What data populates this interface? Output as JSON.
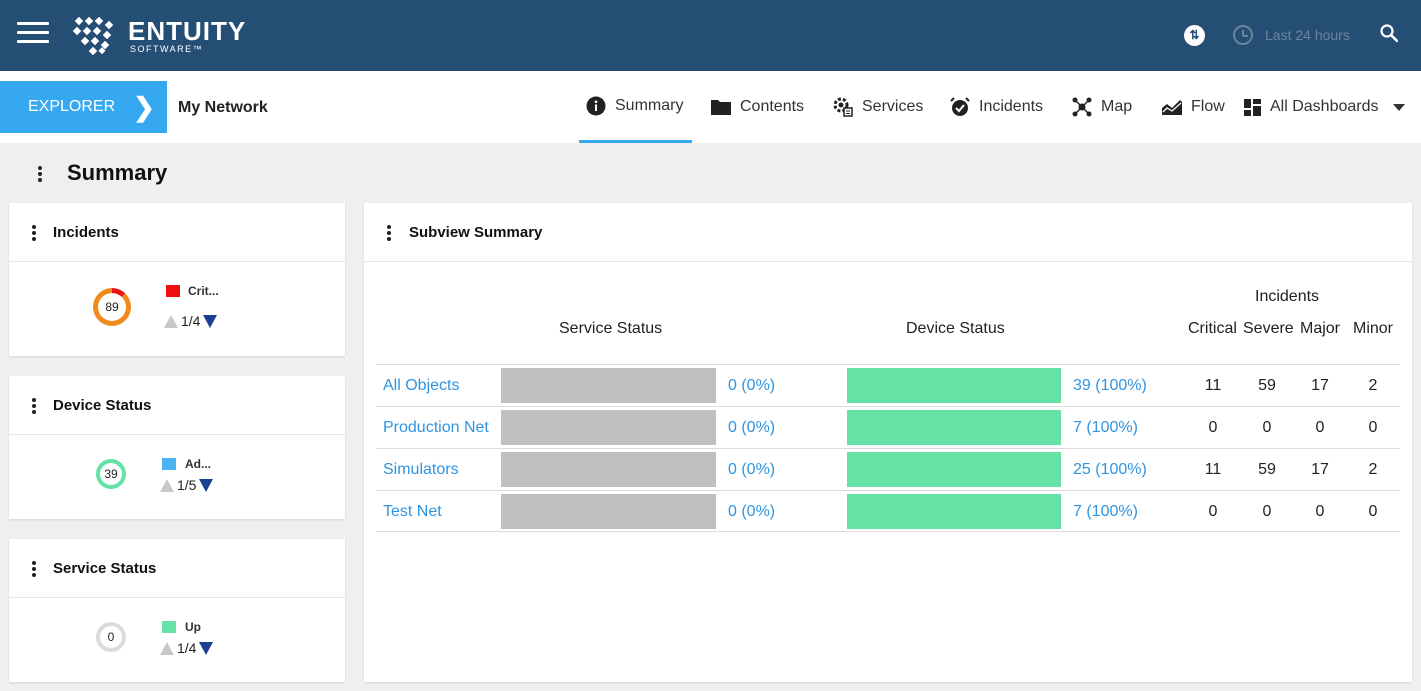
{
  "header": {
    "brand_main": "ENTUITY",
    "brand_sub": "SOFTWARE™",
    "time_range": "Last 24 hours",
    "sync_symbol": "⇅",
    "icons": [
      "menu-icon",
      "sync-icon",
      "clock-icon",
      "search-icon"
    ]
  },
  "nav": {
    "explorer_label": "EXPLORER",
    "explorer_chevron": "❯",
    "network_name": "My Network",
    "tabs": [
      {
        "label": "Summary",
        "icon": "info-icon"
      },
      {
        "label": "Contents",
        "icon": "folder-icon"
      },
      {
        "label": "Services",
        "icon": "services-gear-icon"
      },
      {
        "label": "Incidents",
        "icon": "alarm-icon"
      },
      {
        "label": "Map",
        "icon": "map-network-icon"
      },
      {
        "label": "Flow",
        "icon": "flow-chart-icon"
      },
      {
        "label": "All Dashboards",
        "icon": "dashboard-grid-icon"
      }
    ]
  },
  "page": {
    "title": "Summary"
  },
  "widgets": {
    "incidents": {
      "title": "Incidents",
      "total": "89",
      "legend_label": "Crit...",
      "page": "1/4",
      "legend_color": "#ee1111"
    },
    "device_status": {
      "title": "Device Status",
      "total": "39",
      "legend_label": "Ad...",
      "page": "1/5",
      "legend_color": "#4ab3f4"
    },
    "service_status": {
      "title": "Service Status",
      "total": "0",
      "legend_label": "Up",
      "page": "1/4",
      "legend_color": "#66e2a6"
    }
  },
  "subview": {
    "title": "Subview Summary",
    "headers": {
      "service_status": "Service Status",
      "device_status": "Device Status",
      "incidents_group": "Incidents",
      "critical": "Critical",
      "severe": "Severe",
      "major": "Major",
      "minor": "Minor"
    },
    "rows": [
      {
        "name": "All Objects",
        "service_label": "0 (0%)",
        "service_up_fraction": 0,
        "device_label": "39 (100%)",
        "device_up_fraction": 1,
        "critical": "11",
        "severe": "59",
        "major": "17",
        "minor": "2"
      },
      {
        "name": "Production Net",
        "service_label": "0 (0%)",
        "service_up_fraction": 0,
        "device_label": "7 (100%)",
        "device_up_fraction": 1,
        "critical": "0",
        "severe": "0",
        "major": "0",
        "minor": "0"
      },
      {
        "name": "Simulators",
        "service_label": "0 (0%)",
        "service_up_fraction": 0,
        "device_label": "25 (100%)",
        "device_up_fraction": 1,
        "critical": "11",
        "severe": "59",
        "major": "17",
        "minor": "2"
      },
      {
        "name": "Test Net",
        "service_label": "0 (0%)",
        "service_up_fraction": 0,
        "device_label": "7 (100%)",
        "device_up_fraction": 1,
        "critical": "0",
        "severe": "0",
        "major": "0",
        "minor": "0"
      }
    ]
  },
  "colors": {
    "header_bg": "#254e74",
    "accent": "#35a8f0",
    "link": "#2f95e0",
    "up_green": "#66e2a6",
    "unknown_gray": "#c0c0c0",
    "critical_red": "#ee1111",
    "major_orange": "#f08a1c"
  }
}
